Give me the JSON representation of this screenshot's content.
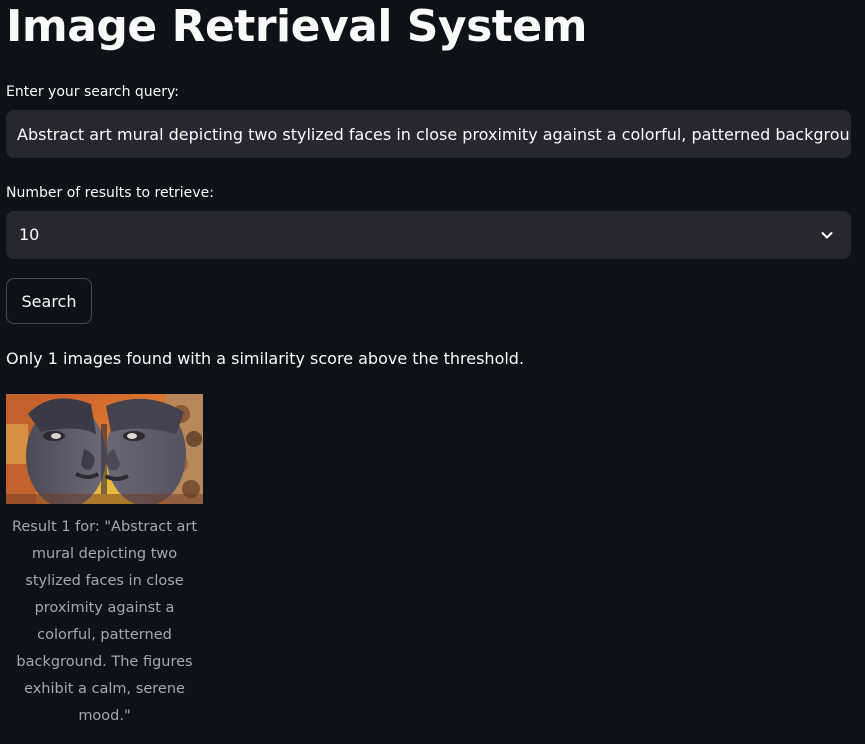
{
  "page": {
    "title": "Image Retrieval System"
  },
  "search": {
    "query_label": "Enter your search query:",
    "query_value": "Abstract art mural depicting two stylized faces in close proximity against a colorful, patterned background. The figures exhibit a calm, serene mood.",
    "count_label": "Number of results to retrieve:",
    "count_value": "10",
    "button_label": "Search"
  },
  "results": {
    "status_text": "Only 1 images found with a similarity score above the threshold.",
    "items": [
      {
        "caption": "Result 1 for: \"Abstract art mural depicting two stylized faces in close proximity against a colorful, patterned background. The figures exhibit a calm, serene mood.\""
      }
    ]
  },
  "theme": {
    "background": "#0e1117",
    "input_background": "#262730",
    "text": "#fafafa",
    "caption_text": "#a3a8b4"
  },
  "icons": {
    "select_chevron": "chevron-down-icon"
  }
}
